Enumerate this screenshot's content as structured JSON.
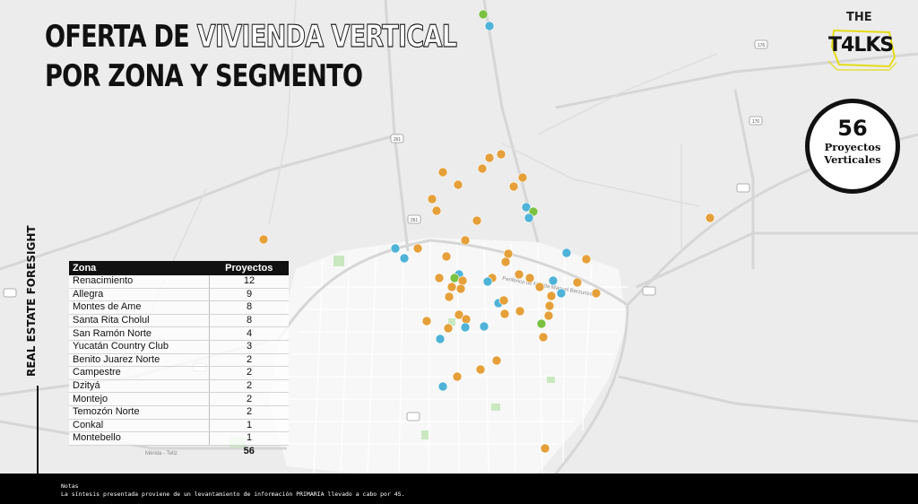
{
  "title": {
    "line1_solid": "OFERTA DE",
    "line1_outline": "VIVIENDA VERTICAL",
    "line2": "POR ZONA Y SEGMENTO"
  },
  "logo": {
    "top": "THE",
    "bottom": "T4LKS"
  },
  "summary": {
    "count": "56",
    "line1": "Proyectos",
    "line2": "Verticales"
  },
  "side_label": {
    "part1": "REAL ESTATE",
    "part2": "FORESIGHT"
  },
  "table": {
    "headers": [
      "Zona",
      "Proyectos"
    ],
    "rows": [
      {
        "zona": "Renacimiento",
        "proyectos": "12"
      },
      {
        "zona": "Allegra",
        "proyectos": "9"
      },
      {
        "zona": "Montes de Ame",
        "proyectos": "8"
      },
      {
        "zona": "Santa Rita Cholul",
        "proyectos": "8"
      },
      {
        "zona": "San Ramón Norte",
        "proyectos": "4"
      },
      {
        "zona": "Yucatán Country Club",
        "proyectos": "3"
      },
      {
        "zona": "Benito Juarez Norte",
        "proyectos": "2"
      },
      {
        "zona": "Campestre",
        "proyectos": "2"
      },
      {
        "zona": "Dzityá",
        "proyectos": "2"
      },
      {
        "zona": "Montejo",
        "proyectos": "2"
      },
      {
        "zona": "Temozón Norte",
        "proyectos": "2"
      },
      {
        "zona": "Conkal",
        "proyectos": "1"
      },
      {
        "zona": "Montebello",
        "proyectos": "1"
      }
    ],
    "total": "56"
  },
  "map": {
    "road_labels": [
      "261",
      "176",
      "Periférico de Mérida Manuel Berzunza",
      "Mérida - Tetiz"
    ],
    "colors": {
      "orange": "#e5a03a",
      "blue": "#4fb3d8",
      "green": "#7ac142"
    }
  },
  "notes": {
    "title": "Notas",
    "text": "La síntesis presentada proviene de un levantamiento de información PRIMARIA llevado a cabo por 4S."
  }
}
